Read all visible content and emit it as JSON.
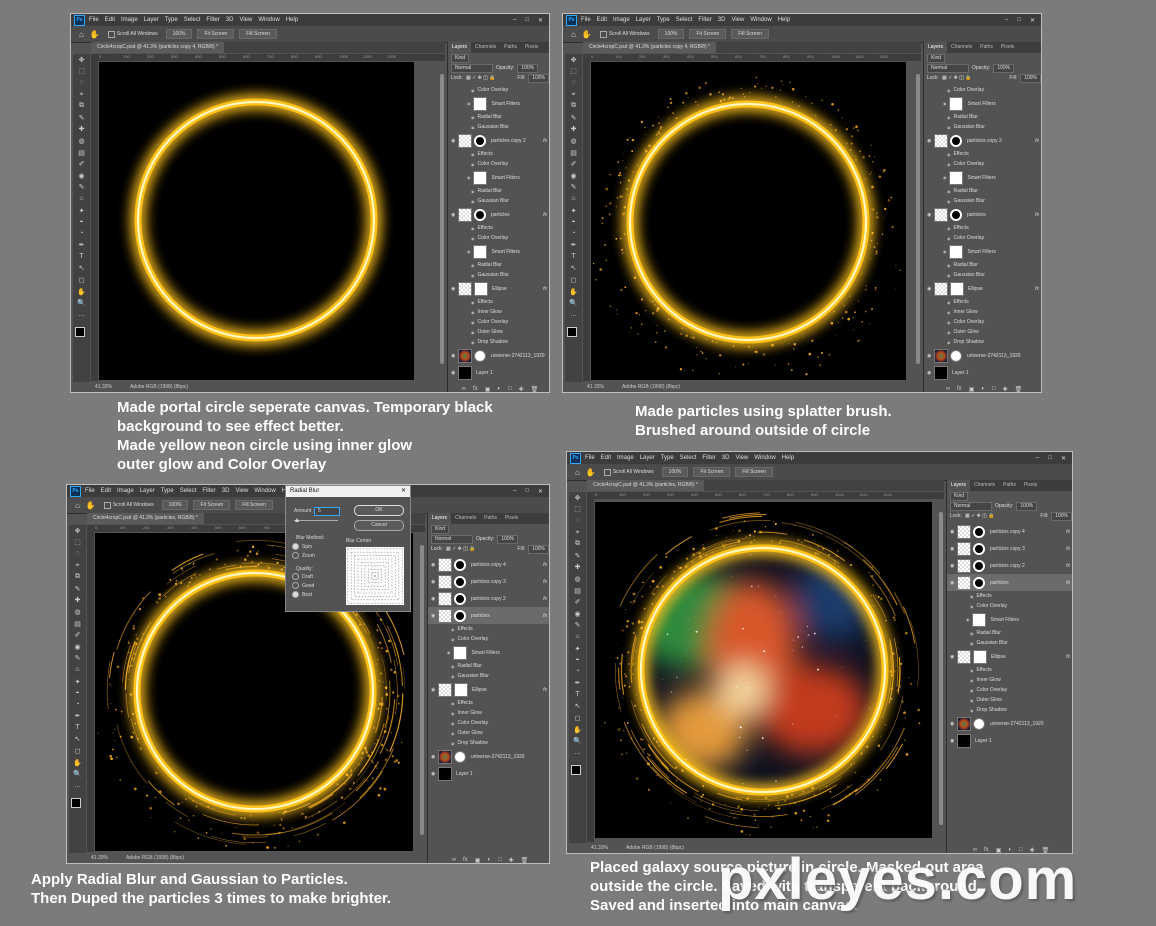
{
  "menu": [
    "File",
    "Edit",
    "Image",
    "Layer",
    "Type",
    "Select",
    "Filter",
    "3D",
    "View",
    "Window",
    "Help"
  ],
  "ps_logo": "Ps",
  "options": {
    "scroll_all": "Scroll All Windows",
    "zoom": "100%",
    "fit": "Fit Screen",
    "fill": "Fill Screen"
  },
  "panel_tabs": [
    "Layers",
    "Channels",
    "Paths",
    "Pixels"
  ],
  "panel_controls": {
    "kind": "Kind",
    "blend": "Normal",
    "opacity_label": "Opacity:",
    "opacity": "100%",
    "lock_label": "Lock:",
    "fill_label": "Fill:",
    "fill": "100%"
  },
  "status_zoom": "41.33%",
  "status_profile": "Adobe RGB (1998) (8bpc)",
  "ruler_ticks": [
    "0",
    "100",
    "200",
    "300",
    "400",
    "500",
    "600",
    "700",
    "800",
    "900",
    "1000",
    "1100",
    "1200"
  ],
  "windows": [
    {
      "doc_tab": "Circle4cropC.psd @ 41.3% (particles copy 4, RGB/8) *",
      "layers": [
        {
          "t": "sub",
          "label": "Color Overlay"
        },
        {
          "t": "filter",
          "label": "Smart Filters"
        },
        {
          "t": "sub",
          "label": "Radial Blur"
        },
        {
          "t": "sub",
          "label": "Gaussian Blur"
        },
        {
          "t": "layer",
          "label": "particles copy 2",
          "fx": "fx"
        },
        {
          "t": "sub",
          "label": "Effects"
        },
        {
          "t": "sub",
          "label": "Color Overlay"
        },
        {
          "t": "filter",
          "label": "Smart Filters"
        },
        {
          "t": "sub",
          "label": "Radial Blur"
        },
        {
          "t": "sub",
          "label": "Gaussian Blur"
        },
        {
          "t": "layer",
          "label": "particles",
          "fx": "fx"
        },
        {
          "t": "sub",
          "label": "Effects"
        },
        {
          "t": "sub",
          "label": "Color Overlay"
        },
        {
          "t": "filter",
          "label": "Smart Filters"
        },
        {
          "t": "sub",
          "label": "Radial Blur"
        },
        {
          "t": "sub",
          "label": "Gaussian Blur"
        },
        {
          "t": "ellipse",
          "label": "Ellipse",
          "fx": "fx"
        },
        {
          "t": "sub",
          "label": "Effects"
        },
        {
          "t": "sub",
          "label": "Inner Glow"
        },
        {
          "t": "sub",
          "label": "Color Overlay"
        },
        {
          "t": "sub",
          "label": "Outer Glow"
        },
        {
          "t": "sub",
          "label": "Drop Shadow"
        },
        {
          "t": "galaxy",
          "label": "universe-2742113_1920"
        },
        {
          "t": "black",
          "label": "Layer 1"
        }
      ]
    },
    {
      "doc_tab": "Circle4cropC.psd @ 41.3% (particles copy 4, RGB/8) *",
      "layers": [
        {
          "t": "sub",
          "label": "Color Overlay"
        },
        {
          "t": "filter",
          "label": "Smart Filters"
        },
        {
          "t": "sub",
          "label": "Radial Blur"
        },
        {
          "t": "sub",
          "label": "Gaussian Blur"
        },
        {
          "t": "layer",
          "label": "particles copy 2",
          "fx": "fx"
        },
        {
          "t": "sub",
          "label": "Effects"
        },
        {
          "t": "sub",
          "label": "Color Overlay"
        },
        {
          "t": "filter",
          "label": "Smart Filters"
        },
        {
          "t": "sub",
          "label": "Radial Blur"
        },
        {
          "t": "sub",
          "label": "Gaussian Blur"
        },
        {
          "t": "layer",
          "label": "particles",
          "fx": "fx"
        },
        {
          "t": "sub",
          "label": "Effects"
        },
        {
          "t": "sub",
          "label": "Color Overlay"
        },
        {
          "t": "filter",
          "label": "Smart Filters"
        },
        {
          "t": "sub",
          "label": "Radial Blur"
        },
        {
          "t": "sub",
          "label": "Gaussian Blur"
        },
        {
          "t": "ellipse",
          "label": "Ellipse",
          "fx": "fx"
        },
        {
          "t": "sub",
          "label": "Effects"
        },
        {
          "t": "sub",
          "label": "Inner Glow"
        },
        {
          "t": "sub",
          "label": "Color Overlay"
        },
        {
          "t": "sub",
          "label": "Outer Glow"
        },
        {
          "t": "sub",
          "label": "Drop Shadow"
        },
        {
          "t": "galaxy",
          "label": "universe-2742113_1920"
        },
        {
          "t": "black",
          "label": "Layer 1"
        }
      ]
    },
    {
      "doc_tab": "Circle4cropC.psd @ 41.3% (particles, RGB/8) *",
      "layers": [
        {
          "t": "layer",
          "label": "particles copy 4",
          "fx": "fx"
        },
        {
          "t": "layer",
          "label": "particles copy 3",
          "fx": "fx"
        },
        {
          "t": "layer",
          "label": "particles copy 2",
          "fx": "fx"
        },
        {
          "t": "layer",
          "label": "particles",
          "fx": "fx",
          "sel": true
        },
        {
          "t": "sub",
          "label": "Effects"
        },
        {
          "t": "sub",
          "label": "Color Overlay"
        },
        {
          "t": "filter",
          "label": "Smart Filters"
        },
        {
          "t": "sub",
          "label": "Radial Blur"
        },
        {
          "t": "sub",
          "label": "Gaussian Blur"
        },
        {
          "t": "ellipse",
          "label": "Ellipse",
          "fx": "fx"
        },
        {
          "t": "sub",
          "label": "Effects"
        },
        {
          "t": "sub",
          "label": "Inner Glow"
        },
        {
          "t": "sub",
          "label": "Color Overlay"
        },
        {
          "t": "sub",
          "label": "Outer Glow"
        },
        {
          "t": "sub",
          "label": "Drop Shadow"
        },
        {
          "t": "galaxy",
          "label": "universe-2742113_1920"
        },
        {
          "t": "black",
          "label": "Layer 1"
        }
      ]
    },
    {
      "doc_tab": "Circle4cropC.psd @ 41.3% (particles, RGB/8) *",
      "layers": [
        {
          "t": "layer",
          "label": "particles copy 4",
          "fx": "fx"
        },
        {
          "t": "layer",
          "label": "particles copy 3",
          "fx": "fx"
        },
        {
          "t": "layer",
          "label": "particles copy 2",
          "fx": "fx"
        },
        {
          "t": "layer",
          "label": "particles",
          "fx": "fx",
          "sel": true
        },
        {
          "t": "sub",
          "label": "Effects"
        },
        {
          "t": "sub",
          "label": "Color Overlay"
        },
        {
          "t": "filter",
          "label": "Smart Filters"
        },
        {
          "t": "sub",
          "label": "Radial Blur"
        },
        {
          "t": "sub",
          "label": "Gaussian Blur"
        },
        {
          "t": "ellipse",
          "label": "Ellipse",
          "fx": "fx"
        },
        {
          "t": "sub",
          "label": "Effects"
        },
        {
          "t": "sub",
          "label": "Inner Glow"
        },
        {
          "t": "sub",
          "label": "Color Overlay"
        },
        {
          "t": "sub",
          "label": "Outer Glow"
        },
        {
          "t": "sub",
          "label": "Drop Shadow"
        },
        {
          "t": "galaxy",
          "label": "universe-2742113_1920"
        },
        {
          "t": "black",
          "label": "Layer 1"
        }
      ]
    }
  ],
  "radial_blur": {
    "title": "Radial Blur",
    "amount_label": "Amount",
    "amount": "5",
    "ok": "OK",
    "cancel": "Cancel",
    "method_label": "Blur Method:",
    "spin": "Spin",
    "zoom": "Zoom",
    "quality_label": "Quality:",
    "draft": "Draft",
    "good": "Good",
    "best": "Best",
    "center_label": "Blur Center"
  },
  "captions": {
    "c1": [
      "Made portal circle seperate canvas. Temporary black",
      "background to see effect better.",
      "Made yellow neon circle using inner glow",
      "outer glow and Color Overlay"
    ],
    "c2": [
      "Made particles using splatter brush.",
      "Brushed around outside of circle"
    ],
    "c3": [
      "Apply Radial Blur and Gaussian to Particles.",
      "Then Duped the particles 3 times to make brighter."
    ],
    "c4": [
      "Placed galaxy source picture in circle. Masked out area",
      "outside  the circle. Saved with transparent background.",
      "Saved and inserted into main canvas."
    ]
  },
  "watermark": "pxleyes.com",
  "colors": {
    "neon": "#ffc21a",
    "neon_core": "#fff6c0",
    "particle": "#f0a820"
  }
}
